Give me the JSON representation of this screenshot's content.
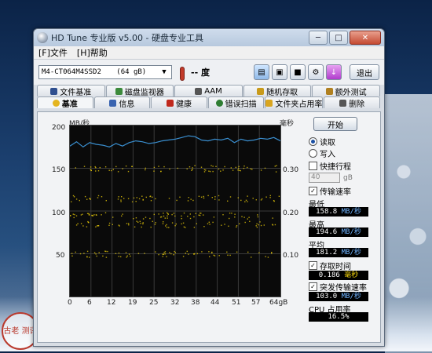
{
  "window": {
    "title": "HD Tune 专业版 v5.00 - 硬盘专业工具",
    "buttons": {
      "minimize": "─",
      "maximize": "□",
      "close": "✕"
    }
  },
  "menu": [
    {
      "label": "[F]文件"
    },
    {
      "label": "[H]帮助"
    }
  ],
  "toolbar": {
    "drive": "M4-CT064M4SSD2",
    "drive_size": "(64 gB)",
    "temperature": "-- 度",
    "exit_label": "退出"
  },
  "tabs_top": [
    {
      "label": "文件基准",
      "icon_color": "#2f4f8f"
    },
    {
      "label": "磁盘监视器",
      "icon_color": "#3c8a3c"
    },
    {
      "label": "AAM",
      "icon_color": "#555555"
    },
    {
      "label": "随机存取",
      "icon_color": "#c89a1a"
    },
    {
      "label": "额外测试",
      "icon_color": "#b08020"
    }
  ],
  "tabs_bottom": [
    {
      "label": "基准",
      "icon_color": "#e4b520",
      "selected": true
    },
    {
      "label": "信息",
      "icon_color": "#3a64b0"
    },
    {
      "label": "健康",
      "icon_color": "#c0281c"
    },
    {
      "label": "错误扫描",
      "icon_color": "#2e7d32"
    },
    {
      "label": "文件夹占用率",
      "icon_color": "#d9a520"
    },
    {
      "label": "删除",
      "icon_color": "#555555"
    }
  ],
  "chart": {
    "left_axis_title": "MB/秒",
    "right_axis_title": "毫秒",
    "left_ticks": [
      "200",
      "150",
      "100",
      "50"
    ],
    "right_ticks": [
      "0.40",
      "0.30",
      "0.20",
      "0.10"
    ],
    "x_ticks": [
      "0",
      "6",
      "12",
      "19",
      "25",
      "32",
      "38",
      "44",
      "51",
      "57",
      "64gB"
    ]
  },
  "chart_data": {
    "type": "line",
    "xlabel": "",
    "ylabel": "MB/秒",
    "y2label": "毫秒",
    "xlim": [
      0,
      64
    ],
    "ylim": [
      0,
      200
    ],
    "y2lim": [
      0,
      0.4
    ],
    "grid": true,
    "series": [
      {
        "name": "传输速率",
        "color": "#3a8fd0",
        "x": [
          0,
          2,
          4,
          6,
          8,
          10,
          12,
          14,
          16,
          18,
          20,
          22,
          24,
          26,
          28,
          30,
          32,
          34,
          36,
          38,
          40,
          42,
          44,
          46,
          48,
          50,
          52,
          54,
          56,
          58,
          60,
          62,
          64
        ],
        "y": [
          176,
          181,
          175,
          180,
          178,
          177,
          175,
          179,
          176,
          180,
          182,
          181,
          179,
          180,
          182,
          183,
          184,
          186,
          188,
          187,
          183,
          182,
          184,
          183,
          185,
          180,
          184,
          182,
          183,
          185,
          184,
          186,
          182
        ]
      },
      {
        "name": "存取时间",
        "color": "#f1d10a",
        "bands_ms": [
          0.1,
          0.17,
          0.19,
          0.23,
          0.3
        ]
      }
    ]
  },
  "results": {
    "start_label": "开始",
    "read_label": "读取",
    "write_label": "写入",
    "short_stroke_label": "快捷行程",
    "short_stroke_value": "40",
    "short_stroke_unit": "gB",
    "transfer_rate_label": "传输速率",
    "min_label": "最低",
    "min_value": "158.8",
    "max_label": "最高",
    "max_value": "194.6",
    "avg_label": "平均",
    "avg_value": "181.2",
    "rate_unit": "MB/秒",
    "access_time_label": "存取时间",
    "access_time_value": "0.186",
    "access_time_unit": "毫秒",
    "burst_label": "突发传输速率",
    "burst_value": "103.0",
    "cpu_label": "CPU 占用率",
    "cpu_value": "16.5%"
  },
  "watermark": "古老 测评"
}
